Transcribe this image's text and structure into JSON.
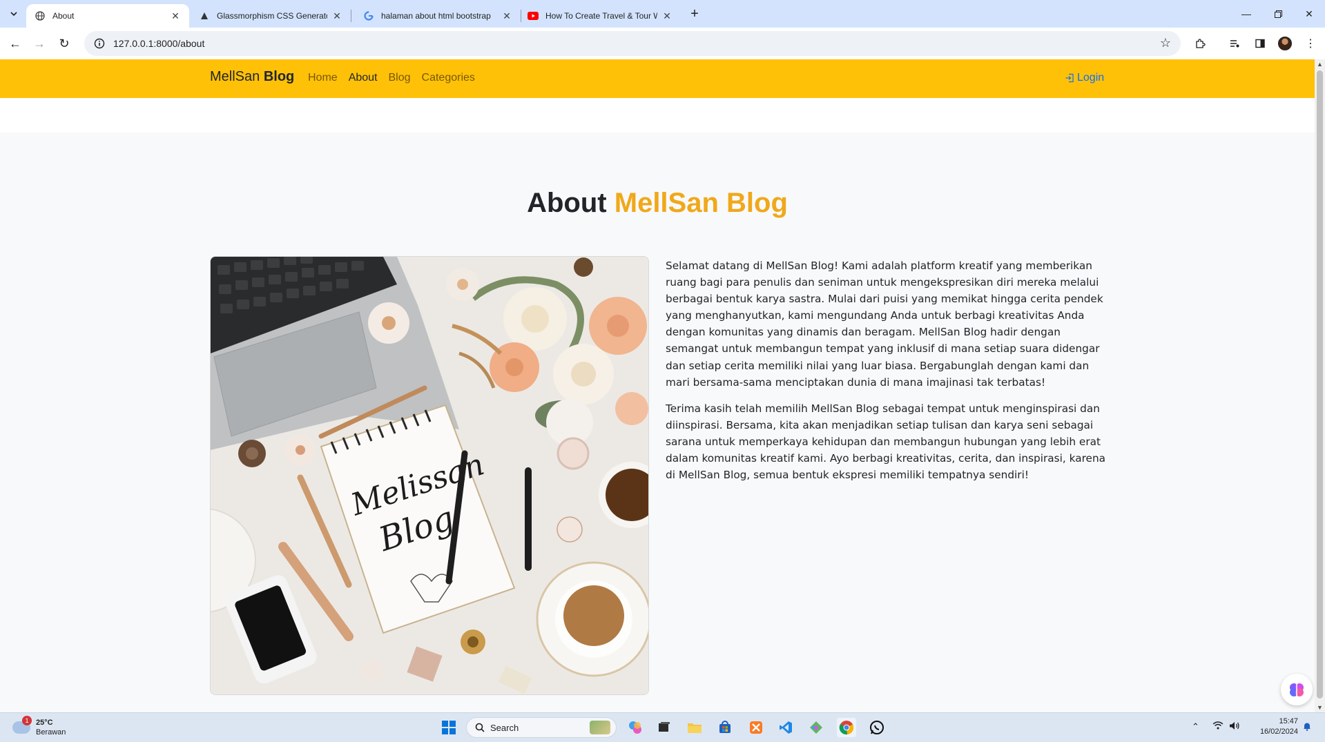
{
  "browser": {
    "tabs": [
      {
        "title": "About",
        "favicon": "globe-icon",
        "active": true
      },
      {
        "title": "Glassmorphism CSS Generator",
        "favicon": "glassmorphism-icon",
        "active": false
      },
      {
        "title": "halaman about html bootstrap",
        "favicon": "google-icon",
        "active": false
      },
      {
        "title": "How To Create Travel & Tour W",
        "favicon": "youtube-icon",
        "active": false
      }
    ],
    "url": "127.0.0.1:8000/about"
  },
  "navbar": {
    "brand_light": "MellSan",
    "brand_bold": "Blog",
    "links": [
      {
        "label": "Home",
        "active": false
      },
      {
        "label": "About",
        "active": true
      },
      {
        "label": "Blog",
        "active": false
      },
      {
        "label": "Categories",
        "active": false
      }
    ],
    "login": "Login",
    "background_color": "#ffc107"
  },
  "about": {
    "title_prefix": "About",
    "title_accent": "MellSan Blog",
    "accent_color": "#f0a81a",
    "image_text_line1": "Melissan",
    "image_text_line2": "Blog",
    "paragraphs": [
      "Selamat datang di MellSan Blog! Kami adalah platform kreatif yang memberikan ruang bagi para penulis dan seniman untuk mengekspresikan diri mereka melalui berbagai bentuk karya sastra. Mulai dari puisi yang memikat hingga cerita pendek yang menghanyutkan, kami mengundang Anda untuk berbagi kreativitas Anda dengan komunitas yang dinamis dan beragam. MellSan Blog hadir dengan semangat untuk membangun tempat yang inklusif di mana setiap suara didengar dan setiap cerita memiliki nilai yang luar biasa. Bergabunglah dengan kami dan mari bersama-sama menciptakan dunia di mana imajinasi tak terbatas!",
      "Terima kasih telah memilih MellSan Blog sebagai tempat untuk menginspirasi dan diinspirasi. Bersama, kita akan menjadikan setiap tulisan dan karya seni sebagai sarana untuk memperkaya kehidupan dan membangun hubungan yang lebih erat dalam komunitas kreatif kami. Ayo berbagi kreativitas, cerita, dan inspirasi, karena di MellSan Blog, semua bentuk ekspresi memiliki tempatnya sendiri!"
    ]
  },
  "taskbar": {
    "weather_temp": "25°C",
    "weather_desc": "Berawan",
    "weather_badge": "1",
    "search_placeholder": "Search",
    "time": "15:47",
    "date": "16/02/2024"
  }
}
